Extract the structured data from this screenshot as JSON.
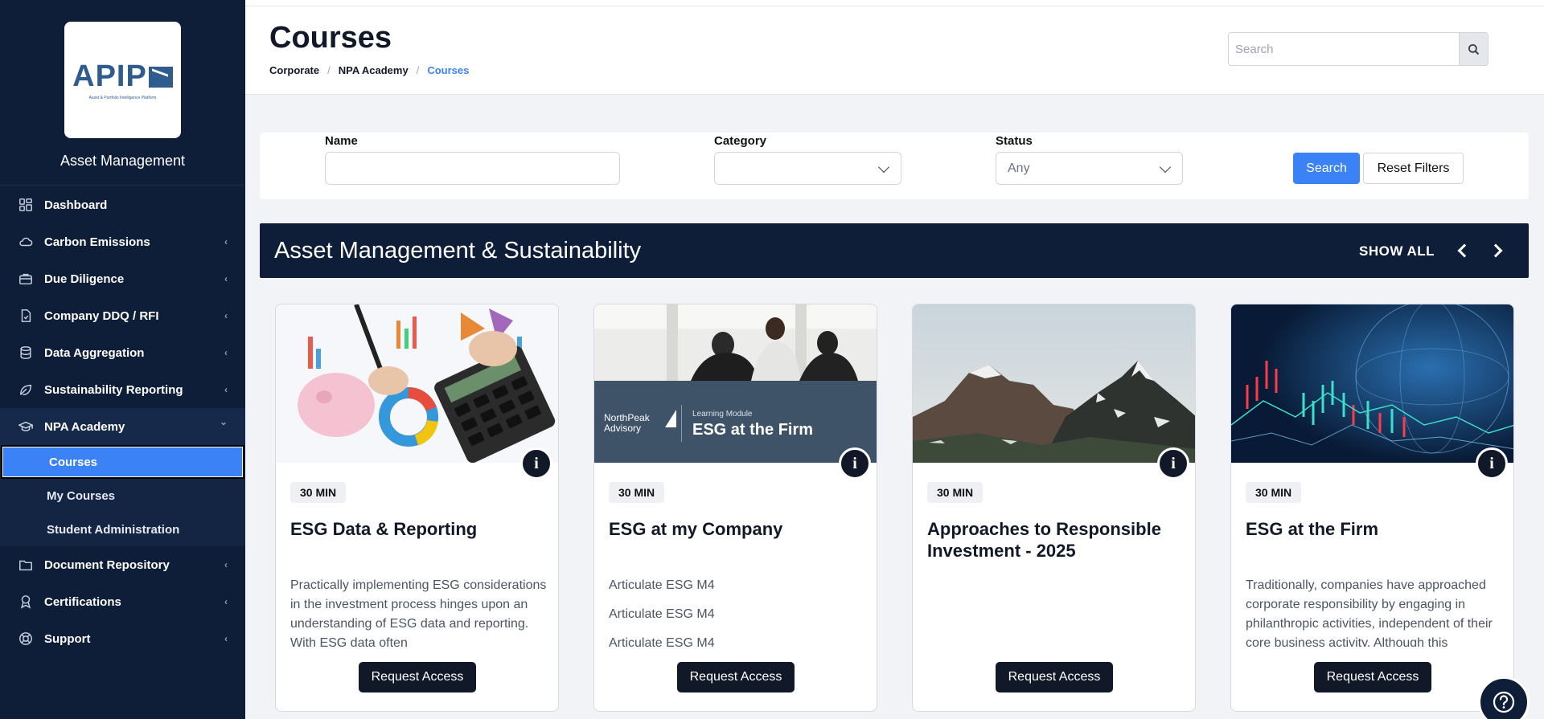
{
  "sidebar": {
    "logo": {
      "text": "APIP",
      "subtext": "Asset & Portfolio Intelligence Platform"
    },
    "brand": "Asset Management",
    "items": [
      {
        "label": "Dashboard",
        "icon": "dashboard-icon",
        "chevron": ""
      },
      {
        "label": "Carbon Emissions",
        "icon": "cloud-icon",
        "chevron": "‹"
      },
      {
        "label": "Due Diligence",
        "icon": "briefcase-icon",
        "chevron": "‹"
      },
      {
        "label": "Company DDQ / RFI",
        "icon": "document-icon",
        "chevron": "‹"
      },
      {
        "label": "Data Aggregation",
        "icon": "database-icon",
        "chevron": "‹"
      },
      {
        "label": "Sustainability Reporting",
        "icon": "leaf-icon",
        "chevron": "‹"
      },
      {
        "label": "NPA Academy",
        "icon": "graduation-cap-icon",
        "chevron": "⌄"
      },
      {
        "label": "Document Repository",
        "icon": "folder-icon",
        "chevron": "‹"
      },
      {
        "label": "Certifications",
        "icon": "award-icon",
        "chevron": "‹"
      },
      {
        "label": "Support",
        "icon": "lifebuoy-icon",
        "chevron": "‹"
      }
    ],
    "academy_sub": [
      {
        "label": "Courses",
        "active": true
      },
      {
        "label": "My Courses",
        "active": false
      },
      {
        "label": "Student Administration",
        "active": false
      }
    ]
  },
  "header": {
    "title": "Courses",
    "breadcrumbs": [
      "Corporate",
      "NPA Academy",
      "Courses"
    ],
    "search_placeholder": "Search"
  },
  "filters": {
    "name_label": "Name",
    "name_value": "",
    "category_label": "Category",
    "category_value": "",
    "status_label": "Status",
    "status_value": "Any",
    "search_button": "Search",
    "reset_button": "Reset Filters"
  },
  "section": {
    "title": "Asset Management & Sustainability",
    "show_all": "SHOW ALL"
  },
  "cards": [
    {
      "duration": "30 MIN",
      "title": "ESG Data & Reporting",
      "description": "Practically implementing ESG considerations in the investment process hinges upon an understanding of ESG data and reporting. With ESG data often",
      "button": "Request Access"
    },
    {
      "duration": "30 MIN",
      "title": "ESG at my Company",
      "description_lines": [
        "Articulate ESG M4",
        "Articulate ESG M4",
        "Articulate ESG M4"
      ],
      "image_brand": "NorthPeak Advisory",
      "image_module_label": "Learning Module",
      "image_module_title": "ESG at the Firm",
      "button": "Request Access"
    },
    {
      "duration": "30 MIN",
      "title": "Approaches to Responsible Investment - 2025",
      "description": "",
      "button": "Request Access"
    },
    {
      "duration": "30 MIN",
      "title": "ESG at the Firm",
      "description": "Traditionally, companies have approached corporate responsibility by engaging in philanthropic activities, independent of their core business activity. Although this",
      "button": "Request Access"
    }
  ],
  "colors": {
    "sidebar_bg": "#0f1e38",
    "accent": "#3b82f6",
    "dark_button": "#111827"
  }
}
